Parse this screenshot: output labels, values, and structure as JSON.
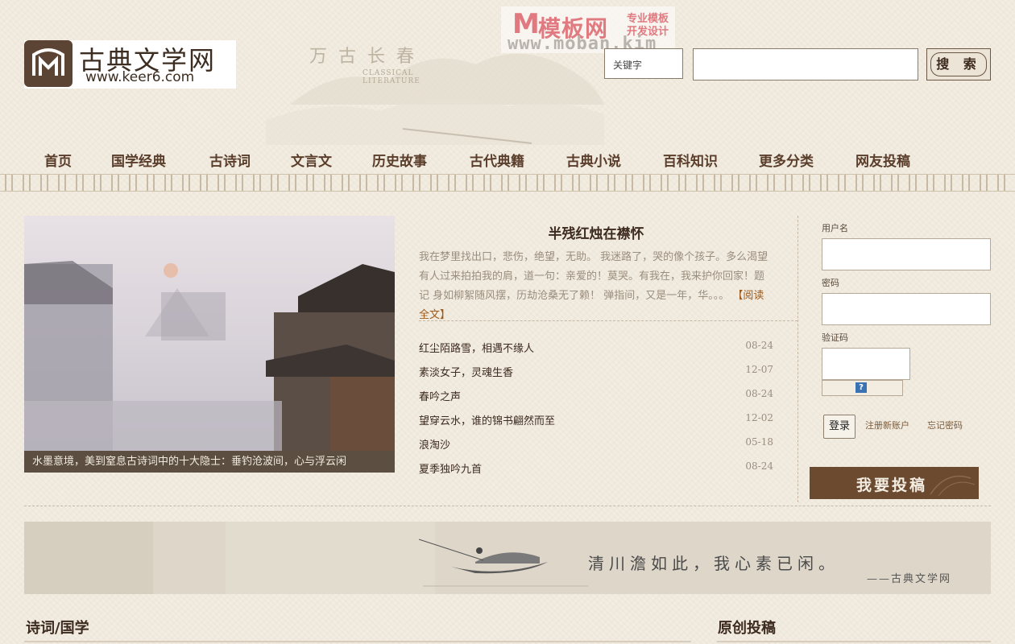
{
  "watermark": {
    "m": "M",
    "title": "模板网",
    "tag1": "专业模板",
    "tag2": "开发设计",
    "url": "www.moban.kim"
  },
  "logo": {
    "title": "古典文学网",
    "url": "www.keer6.com"
  },
  "tagline": {
    "cn": "万古长春",
    "en": "CLASSICAL LITERATURE"
  },
  "search": {
    "keyword_select": "关键字",
    "button": "搜 索"
  },
  "nav": [
    "首页",
    "国学经典",
    "古诗词",
    "文言文",
    "历史故事",
    "古代典籍",
    "古典小说",
    "百科知识",
    "更多分类",
    "网友投稿"
  ],
  "feature": {
    "caption": "水墨意境，美到窒息古诗词中的十大隐士：垂钓沧波间，心与浮云闲"
  },
  "article": {
    "title": "半残红烛在襟怀",
    "excerpt": "我在梦里找出口，悲伤，绝望，无助。 我迷路了，哭的像个孩子。多么渴望有人过来拍拍我的肩，道一句：亲爱的！莫哭。有我在，我来护你回家！题记 身如柳絮随风摆，历劫沧桑无了赖！ 弹指间，又是一年，华。。。",
    "read_more": "【阅读全文】"
  },
  "list": [
    {
      "title": "红尘陌路雪，相遇不缘人",
      "date": "08-24"
    },
    {
      "title": "素淡女子，灵魂生香",
      "date": "12-07"
    },
    {
      "title": "春吟之声",
      "date": "08-24"
    },
    {
      "title": "望穿云水，谁的锦书翩然而至",
      "date": "12-02"
    },
    {
      "title": "浪淘沙",
      "date": "05-18"
    },
    {
      "title": "夏季独吟九首",
      "date": "08-24"
    }
  ],
  "login": {
    "username_label": "用户名",
    "password_label": "密码",
    "captcha_label": "验证码",
    "captcha_icon": "?",
    "login_button": "登录",
    "register": "注册新账户",
    "forgot": "忘记密码",
    "submit_button": "我要投稿"
  },
  "banner": {
    "quote": "清川澹如此，我心素已闲。",
    "signature": "——古典文学网"
  },
  "sections": {
    "left": "诗词/国学",
    "right": "原创投稿"
  },
  "colors": {
    "background": "#f2ece1",
    "brown": "#6b4a30",
    "caption_bg": "#5c4f41",
    "link": "#9c5a1c"
  }
}
